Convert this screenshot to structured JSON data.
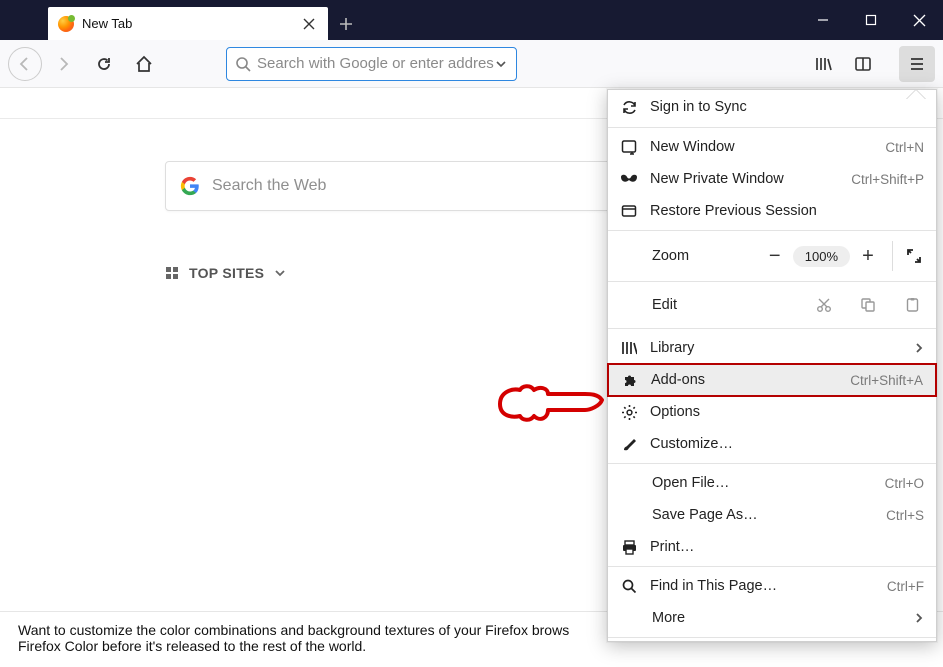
{
  "tab": {
    "title": "New Tab"
  },
  "urlbar": {
    "placeholder": "Search with Google or enter address"
  },
  "content": {
    "search_placeholder": "Search the Web",
    "top_sites_label": "TOP SITES"
  },
  "snippet": {
    "line1": "Want to customize the color combinations and background textures of your Firefox brows",
    "line2": "Firefox Color before it's released to the rest of the world."
  },
  "menu": {
    "sign_in": "Sign in to Sync",
    "new_window": {
      "label": "New Window",
      "shortcut": "Ctrl+N"
    },
    "private_window": {
      "label": "New Private Window",
      "shortcut": "Ctrl+Shift+P"
    },
    "restore": "Restore Previous Session",
    "zoom": {
      "label": "Zoom",
      "value": "100%"
    },
    "edit": {
      "label": "Edit"
    },
    "library": "Library",
    "addons": {
      "label": "Add-ons",
      "shortcut": "Ctrl+Shift+A"
    },
    "options": "Options",
    "customize": "Customize…",
    "open_file": {
      "label": "Open File…",
      "shortcut": "Ctrl+O"
    },
    "save_page": {
      "label": "Save Page As…",
      "shortcut": "Ctrl+S"
    },
    "print": "Print…",
    "find": {
      "label": "Find in This Page…",
      "shortcut": "Ctrl+F"
    },
    "more": "More"
  }
}
